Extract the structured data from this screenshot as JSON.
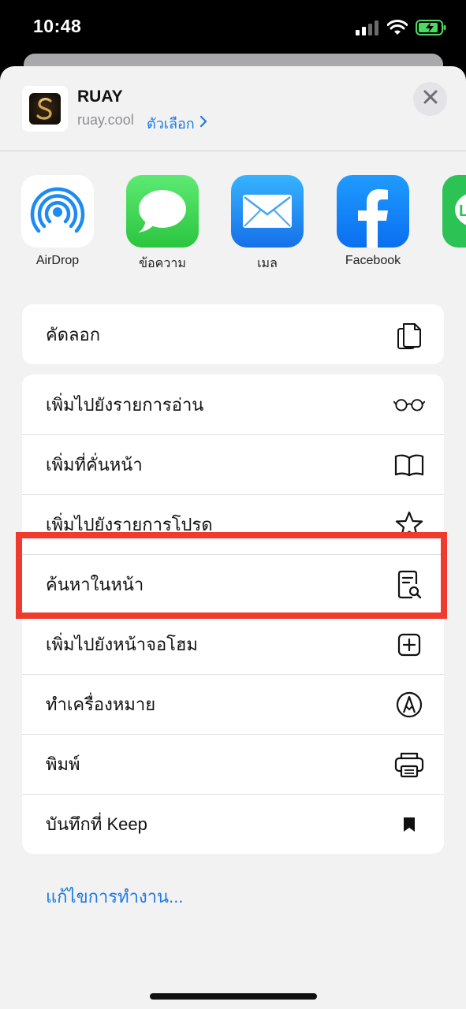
{
  "status_bar": {
    "time": "10:48"
  },
  "header": {
    "title": "RUAY",
    "url": "ruay.cool",
    "options_label": "ตัวเลือก"
  },
  "share_targets": [
    {
      "label": "AirDrop",
      "icon": "airdrop-icon"
    },
    {
      "label": "ข้อความ",
      "icon": "messages-icon"
    },
    {
      "label": "เมล",
      "icon": "mail-icon"
    },
    {
      "label": "Facebook",
      "icon": "facebook-icon"
    },
    {
      "label": "",
      "icon": "line-icon"
    }
  ],
  "actions_group1": [
    {
      "label": "คัดลอก",
      "icon": "copy-icon"
    }
  ],
  "actions_group2": [
    {
      "label": "เพิ่มไปยังรายการอ่าน",
      "icon": "glasses-icon"
    },
    {
      "label": "เพิ่มที่คั่นหน้า",
      "icon": "book-icon"
    },
    {
      "label": "เพิ่มไปยังรายการโปรด",
      "icon": "star-icon"
    },
    {
      "label": "ค้นหาในหน้า",
      "icon": "find-in-page-icon"
    },
    {
      "label": "เพิ่มไปยังหน้าจอโฮม",
      "icon": "add-square-icon"
    },
    {
      "label": "ทำเครื่องหมาย",
      "icon": "markup-icon"
    },
    {
      "label": "พิมพ์",
      "icon": "printer-icon"
    },
    {
      "label": "บันทึกที่ Keep",
      "icon": "bookmark-icon"
    }
  ],
  "edit_actions_label": "แก้ไขการทำงาน...",
  "colors": {
    "accent": "#1b7ae6",
    "highlight": "#f03a2e",
    "sheet_bg": "#f2f2f3"
  }
}
